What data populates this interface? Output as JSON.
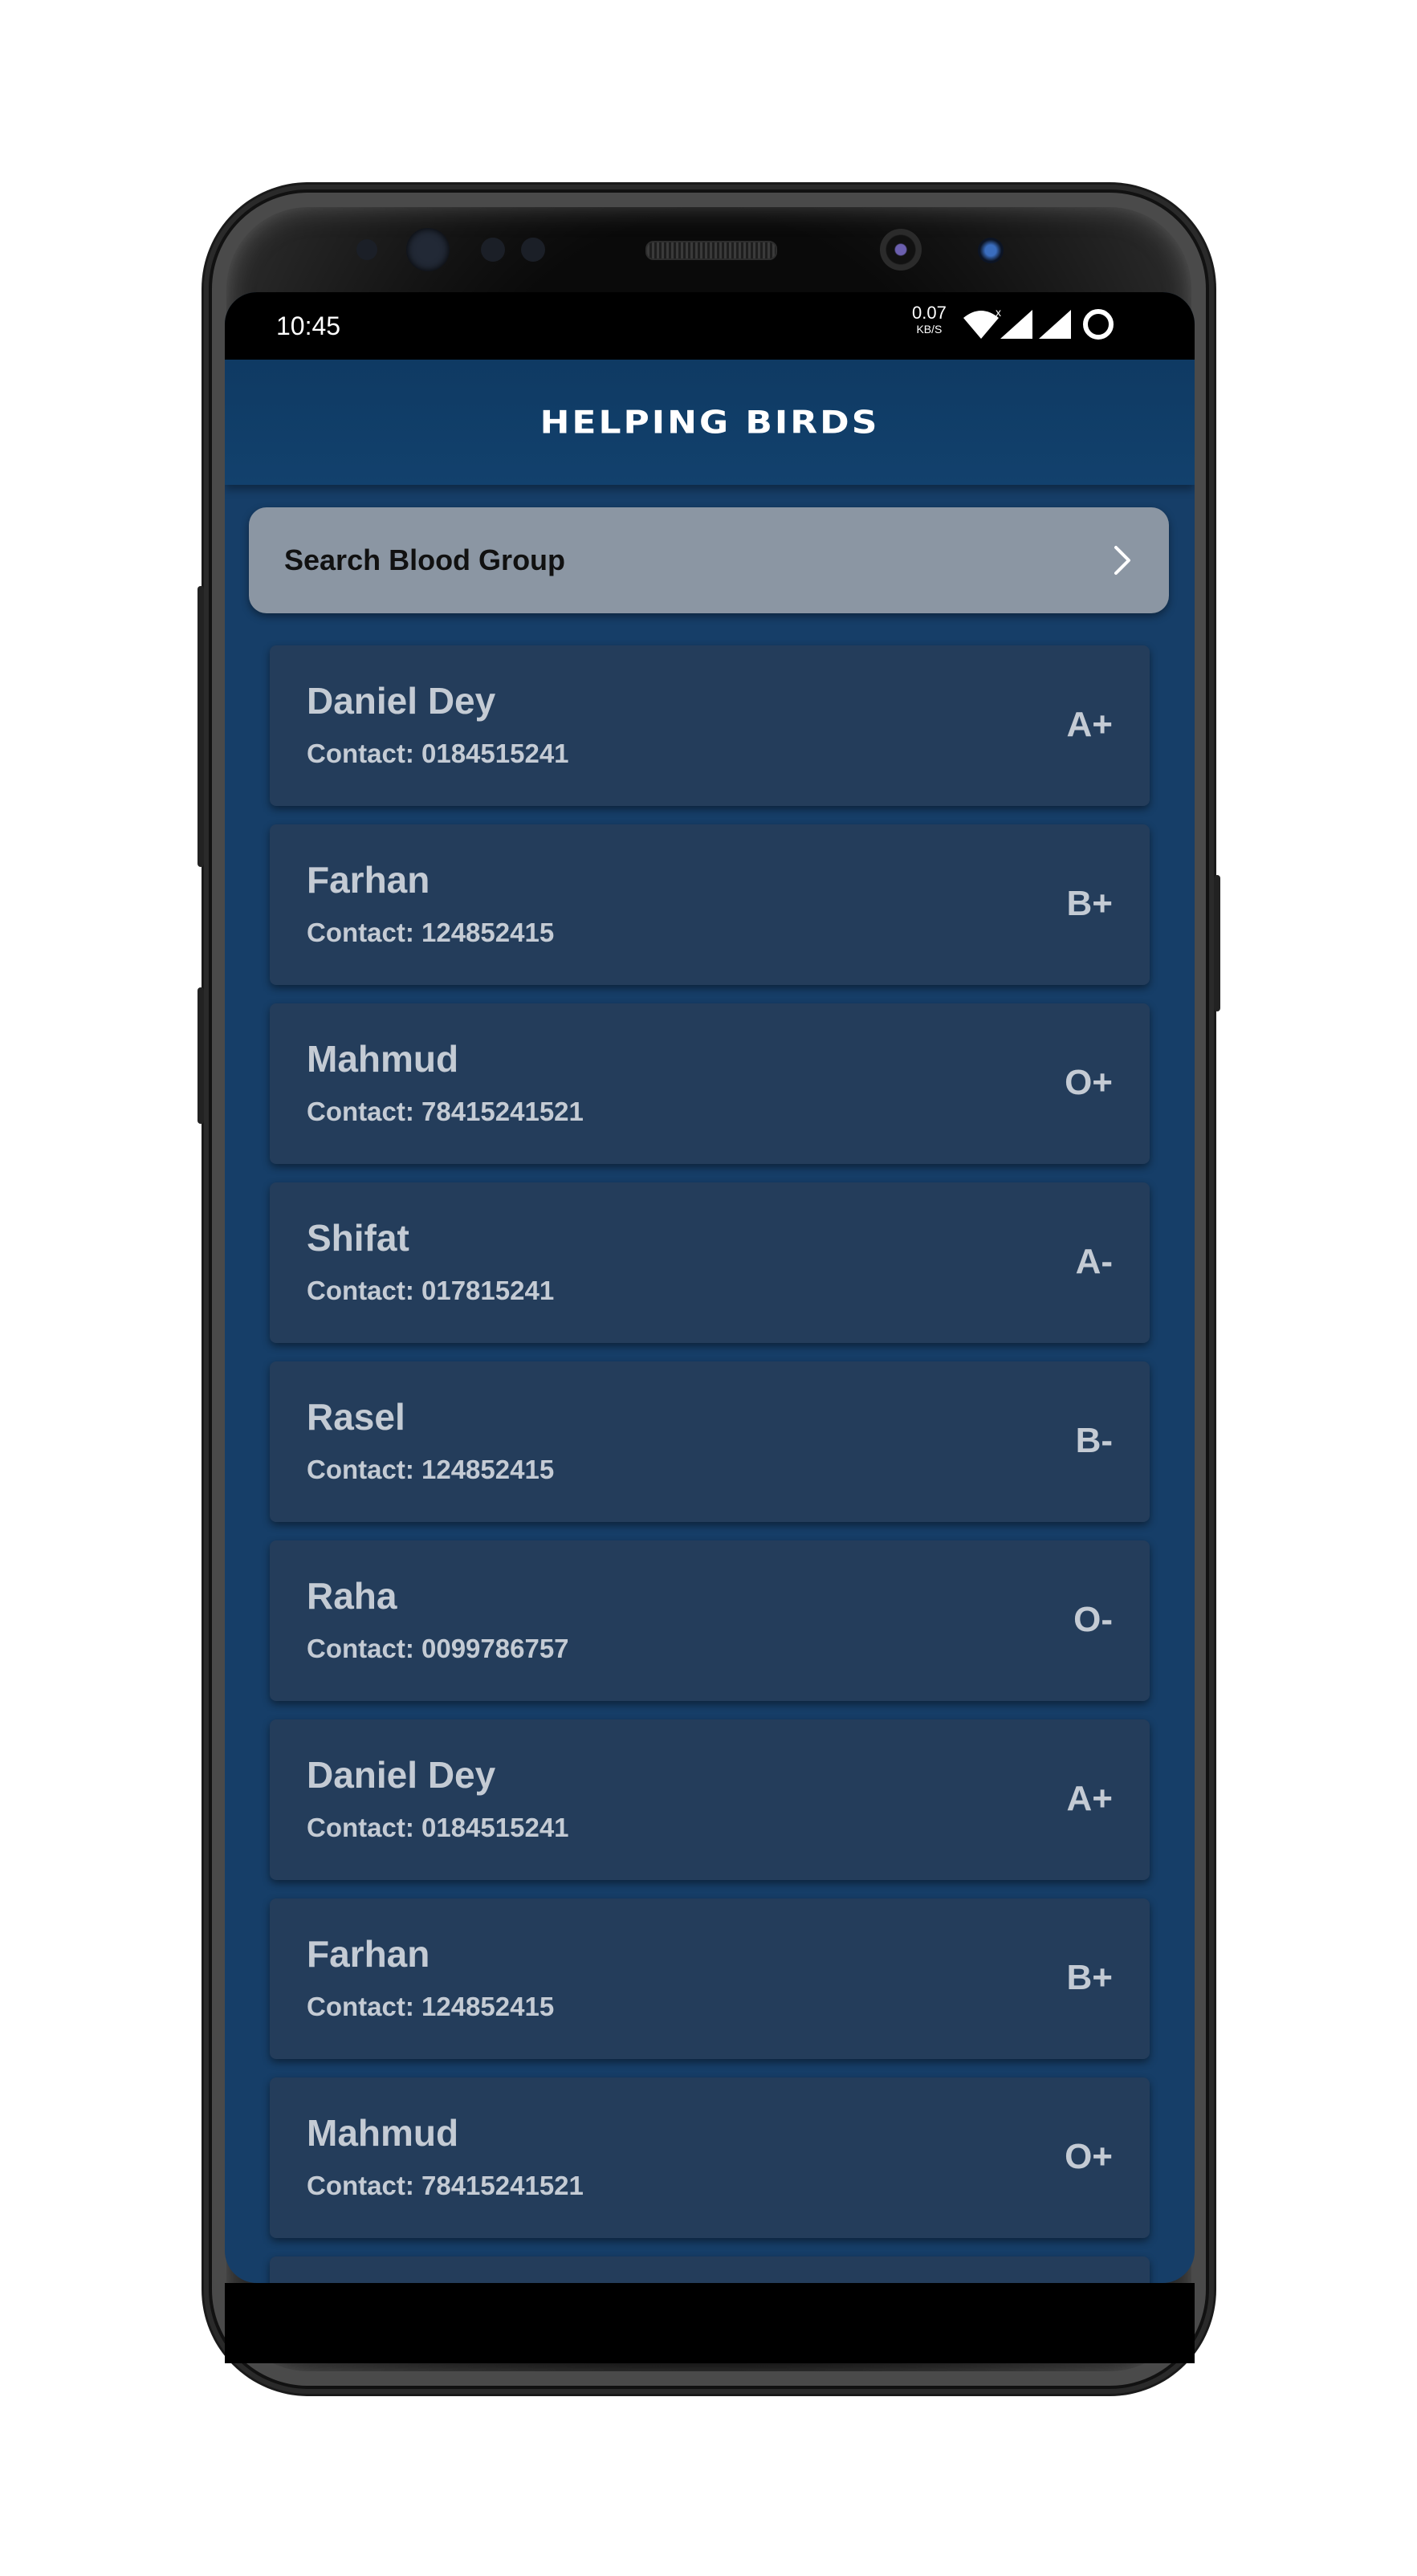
{
  "status_bar": {
    "time": "10:45",
    "speed_value": "0.07",
    "speed_unit": "KB/S"
  },
  "app": {
    "title": "Helping Birds"
  },
  "search": {
    "label": "Search Blood Group",
    "icon": "chevron-right-icon"
  },
  "donors": [
    {
      "name": "Daniel Dey",
      "contact": "Contact: 0184515241",
      "group": "A+"
    },
    {
      "name": "Farhan",
      "contact": "Contact: 124852415",
      "group": "B+"
    },
    {
      "name": "Mahmud",
      "contact": "Contact: 78415241521",
      "group": "O+"
    },
    {
      "name": "Shifat",
      "contact": "Contact: 017815241",
      "group": "A-"
    },
    {
      "name": "Rasel",
      "contact": "Contact: 124852415",
      "group": "B-"
    },
    {
      "name": "Raha",
      "contact": "Contact: 0099786757",
      "group": "O-"
    },
    {
      "name": "Daniel Dey",
      "contact": "Contact: 0184515241",
      "group": "A+"
    },
    {
      "name": "Farhan",
      "contact": "Contact: 124852415",
      "group": "B+"
    },
    {
      "name": "Mahmud",
      "contact": "Contact: 78415241521",
      "group": "O+"
    }
  ],
  "colors": {
    "app_bar": "#0f3a63",
    "background": "#163e68",
    "card": "#243d5b",
    "search_bg": "#8b96a3",
    "text": "#c4cbd4"
  }
}
